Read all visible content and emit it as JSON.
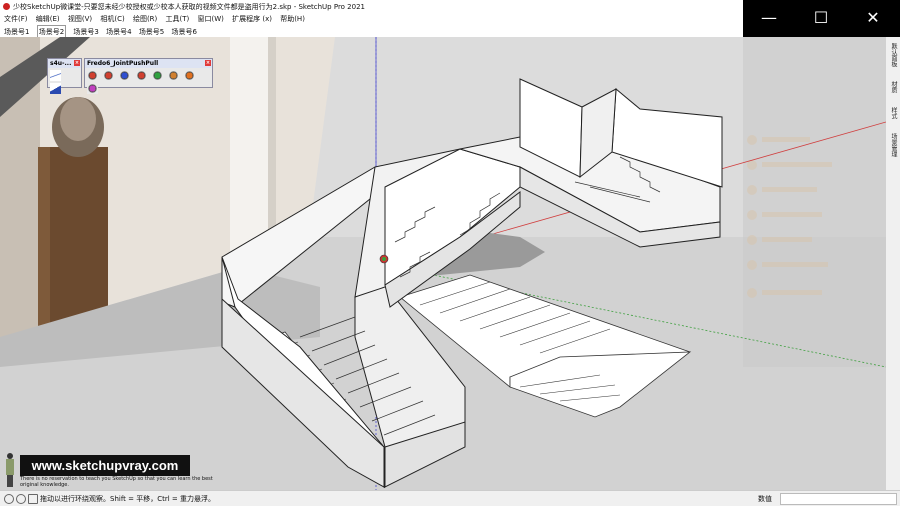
{
  "window": {
    "title": "少校SketchUp微课堂-只要您未经少校授权或少校本人获取的视频文件都是盗用行为2.skp - SketchUp Pro 2021",
    "minimize_glyph": "—",
    "maximize_glyph": "☐",
    "close_glyph": "✕"
  },
  "menubar": {
    "items": [
      "文件(F)",
      "编辑(E)",
      "视图(V)",
      "相机(C)",
      "绘图(R)",
      "工具(T)",
      "窗口(W)",
      "扩展程序 (x)",
      "帮助(H)"
    ]
  },
  "scene_tabs": {
    "items": [
      "场景号1",
      "场景号2",
      "场景号3",
      "场景号4",
      "场景号5",
      "场景号6"
    ],
    "selected_index": 1
  },
  "toolbars": {
    "s4u": {
      "title": "s4u-..."
    },
    "fredo": {
      "title": "Fredo6_JointPushPull"
    }
  },
  "right_panel": {
    "tabs": [
      "默认面板",
      "材质",
      "样式",
      "场景管理"
    ]
  },
  "watermark": {
    "brand": "www.sketchupvray.com",
    "tagline": "There is no reservation to teach you SketchUp so that you can learn the best original knowledge."
  },
  "statusbar": {
    "hint": "拖动以进行环绕观察。Shift = 平移，Ctrl = 重力悬浮。",
    "measurements_label": "数值",
    "measurements_value": ""
  },
  "colors": {
    "accent_red": "#cc2222",
    "window_controls_bg": "#000000",
    "viewport_ground": "#cfcfcf"
  }
}
